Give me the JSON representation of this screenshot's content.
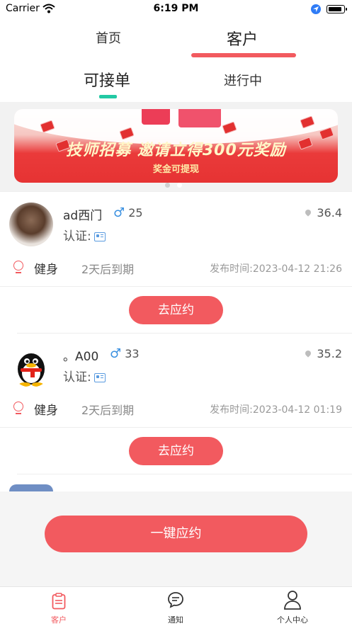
{
  "status_bar": {
    "carrier": "Carrier",
    "time": "6:19 PM",
    "battery_level": 0.9
  },
  "main_tabs": [
    {
      "label": "首页"
    },
    {
      "label": "客户"
    }
  ],
  "sub_tabs": [
    {
      "label": "可接单"
    },
    {
      "label": "进行中"
    }
  ],
  "banner": {
    "title": "技师招募  邀请立得300元奖励",
    "subtitle": "奖金可提现",
    "slide_count": 2,
    "active_slide": 2
  },
  "orders": [
    {
      "name": "ad西门",
      "gender_symbol": "♂",
      "age": "25",
      "auth_label": "认证:",
      "distance": "36.4",
      "service": "健身",
      "expire": "2天后到期",
      "published": "发布时间:2023-04-12 21:26",
      "apply_label": "去应约"
    },
    {
      "name": "。A00",
      "gender_symbol": "♂",
      "age": "33",
      "auth_label": "认证:",
      "distance": "35.2",
      "service": "健身",
      "expire": "2天后到期",
      "published": "发布时间:2023-04-12 01:19",
      "apply_label": "去应约"
    }
  ],
  "one_click_label": "一键应约",
  "tab_bar": [
    {
      "label": "客户"
    },
    {
      "label": "通知"
    },
    {
      "label": "个人中心"
    }
  ],
  "colors": {
    "accent": "#f25a5f",
    "tab_indicator": "#22c9a4",
    "gender": "#3a90e0"
  },
  "icons": {
    "wifi": "wifi-icon",
    "location": "location-arrow-icon",
    "pin": "map-pin-icon",
    "id": "id-card-icon",
    "badge": "medal-icon",
    "orders_tab": "document-list-icon",
    "notify_tab": "chat-bubble-icon",
    "profile_tab": "person-icon"
  }
}
